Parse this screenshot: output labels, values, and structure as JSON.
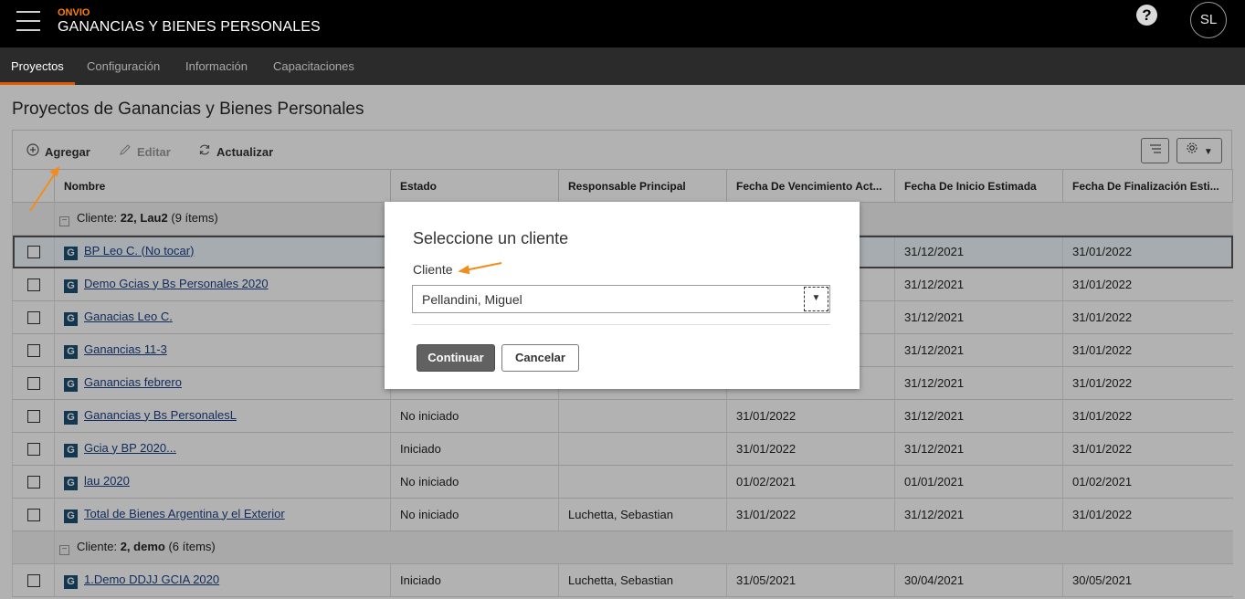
{
  "header": {
    "brand": "ONVIO",
    "app_title": "GANANCIAS Y BIENES PERSONALES",
    "help_glyph": "?",
    "user_initials": "SL"
  },
  "nav": {
    "tabs": [
      {
        "label": "Proyectos",
        "active": true
      },
      {
        "label": "Configuración",
        "active": false
      },
      {
        "label": "Información",
        "active": false
      },
      {
        "label": "Capacitaciones",
        "active": false
      }
    ]
  },
  "page": {
    "title": "Proyectos de Ganancias y Bienes Personales"
  },
  "toolbar": {
    "add_label": "Agregar",
    "edit_label": "Editar",
    "refresh_label": "Actualizar",
    "add_icon": "plus-circle-icon",
    "edit_icon": "pencil-icon",
    "refresh_icon": "refresh-icon",
    "list_icon": "list-icon",
    "settings_icon": "gear-icon"
  },
  "table": {
    "columns": [
      "Nombre",
      "Estado",
      "Responsable Principal",
      "Fecha De Vencimiento Act...",
      "Fecha De Inicio Estimada",
      "Fecha De Finalización Esti..."
    ],
    "groups": [
      {
        "prefix": "Cliente: ",
        "name": "22, Lau2",
        "count": "(9 ítems)",
        "rows": [
          {
            "name": "BP Leo C. (No tocar)",
            "estado": "",
            "responsable": "",
            "vencimiento": "",
            "inicio": "31/12/2021",
            "fin": "31/01/2022",
            "selected": true
          },
          {
            "name": "Demo Gcias y Bs Personales 2020",
            "estado": "",
            "responsable": "",
            "vencimiento": "",
            "inicio": "31/12/2021",
            "fin": "31/01/2022"
          },
          {
            "name": "Ganacias Leo C.",
            "estado": "",
            "responsable": "",
            "vencimiento": "",
            "inicio": "31/12/2021",
            "fin": "31/01/2022"
          },
          {
            "name": "Ganancias 11-3",
            "estado": "",
            "responsable": "",
            "vencimiento": "",
            "inicio": "31/12/2021",
            "fin": "31/01/2022"
          },
          {
            "name": "Ganancias febrero",
            "estado": "",
            "responsable": "",
            "vencimiento": "",
            "inicio": "31/12/2021",
            "fin": "31/01/2022"
          },
          {
            "name": "Ganancias y Bs PersonalesL",
            "estado": "No iniciado",
            "responsable": "",
            "vencimiento": "31/01/2022",
            "inicio": "31/12/2021",
            "fin": "31/01/2022"
          },
          {
            "name": "Gcia y BP 2020...",
            "estado": "Iniciado",
            "responsable": "",
            "vencimiento": "31/01/2022",
            "inicio": "31/12/2021",
            "fin": "31/01/2022"
          },
          {
            "name": "lau 2020",
            "estado": "No iniciado",
            "responsable": "",
            "vencimiento": "01/02/2021",
            "inicio": "01/01/2021",
            "fin": "01/02/2021"
          },
          {
            "name": "Total de Bienes Argentina y el Exterior",
            "estado": "No iniciado",
            "responsable": "Luchetta, Sebastian",
            "vencimiento": "31/01/2022",
            "inicio": "31/12/2021",
            "fin": "31/01/2022"
          }
        ]
      },
      {
        "prefix": "Cliente: ",
        "name": "2, demo",
        "count": "(6 ítems)",
        "rows": [
          {
            "name": "1.Demo DDJJ GCIA 2020",
            "estado": "Iniciado",
            "responsable": "Luchetta, Sebastian",
            "vencimiento": "31/05/2021",
            "inicio": "30/04/2021",
            "fin": "30/05/2021"
          }
        ]
      }
    ]
  },
  "modal": {
    "title": "Seleccione un cliente",
    "field_label": "Cliente",
    "selected_value": "Pellandini, Miguel",
    "continue_label": "Continuar",
    "cancel_label": "Cancelar"
  },
  "colors": {
    "brand": "#ff8000",
    "nav_active_underline": "#e05a00",
    "annotation_arrow": "#f28c1e",
    "project_icon": "#1b4f72"
  }
}
